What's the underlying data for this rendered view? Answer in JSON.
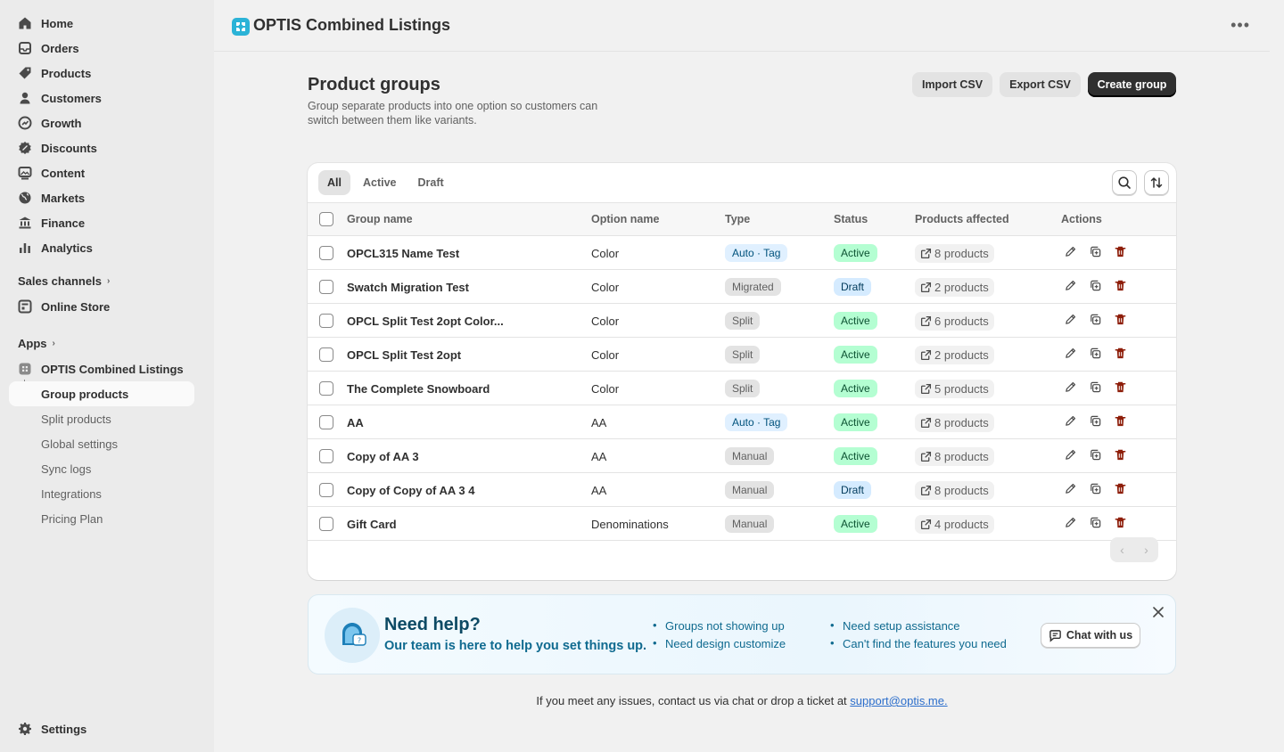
{
  "sidebar": {
    "nav": [
      {
        "label": "Home",
        "icon": "home-icon"
      },
      {
        "label": "Orders",
        "icon": "inbox-icon"
      },
      {
        "label": "Products",
        "icon": "tag-icon"
      },
      {
        "label": "Customers",
        "icon": "person-icon"
      },
      {
        "label": "Growth",
        "icon": "growth-icon"
      },
      {
        "label": "Discounts",
        "icon": "discount-icon"
      },
      {
        "label": "Content",
        "icon": "image-icon"
      },
      {
        "label": "Markets",
        "icon": "globe-icon"
      },
      {
        "label": "Finance",
        "icon": "bank-icon"
      },
      {
        "label": "Analytics",
        "icon": "chart-icon"
      }
    ],
    "sales_channels_label": "Sales channels",
    "online_store_label": "Online Store",
    "apps_label": "Apps",
    "app_name": "OPTIS Combined Listings",
    "app_items": [
      "Group products",
      "Split products",
      "Global settings",
      "Sync logs",
      "Integrations",
      "Pricing Plan"
    ],
    "settings_label": "Settings"
  },
  "header": {
    "app_title": "OPTIS Combined Listings"
  },
  "page": {
    "title": "Product groups",
    "subtitle": "Group separate products into one option so customers can switch between them like variants.",
    "import_label": "Import CSV",
    "export_label": "Export CSV",
    "create_label": "Create group"
  },
  "table": {
    "tabs": [
      "All",
      "Active",
      "Draft"
    ],
    "columns": [
      "Group name",
      "Option name",
      "Type",
      "Status",
      "Products affected",
      "Actions"
    ],
    "rows": [
      {
        "name": "OPCL315 Name Test",
        "option": "Color",
        "type": "Auto · Tag",
        "status": "Active",
        "products": "8 products"
      },
      {
        "name": "Swatch Migration Test",
        "option": "Color",
        "type": "Migrated",
        "status": "Draft",
        "products": "2 products"
      },
      {
        "name": "OPCL Split Test 2opt Color...",
        "option": "Color",
        "type": "Split",
        "status": "Active",
        "products": "6 products"
      },
      {
        "name": "OPCL Split Test 2opt",
        "option": "Color",
        "type": "Split",
        "status": "Active",
        "products": "2 products"
      },
      {
        "name": "The Complete Snowboard",
        "option": "Color",
        "type": "Split",
        "status": "Active",
        "products": "5 products"
      },
      {
        "name": "AA",
        "option": "AA",
        "type": "Auto · Tag",
        "status": "Active",
        "products": "8 products"
      },
      {
        "name": "Copy of AA 3",
        "option": "AA",
        "type": "Manual",
        "status": "Active",
        "products": "8 products"
      },
      {
        "name": "Copy of Copy of AA 3 4",
        "option": "AA",
        "type": "Manual",
        "status": "Draft",
        "products": "8 products"
      },
      {
        "name": "Gift Card",
        "option": "Denominations",
        "type": "Manual",
        "status": "Active",
        "products": "4 products"
      }
    ]
  },
  "help": {
    "title": "Need help?",
    "subtitle": "Our team is here to help you set things up.",
    "list_a": [
      "Groups not showing up",
      "Need design customize"
    ],
    "list_b": [
      "Need setup assistance",
      "Can't find the features you need"
    ],
    "chat_label": "Chat with us"
  },
  "footer": {
    "text": "If you meet any issues, contact us via chat or drop a ticket at ",
    "link": "support@optis.me."
  },
  "colors": {
    "accent": "#303030",
    "active_badge": "#b4fed2",
    "draft_badge": "#d5ebff",
    "delete_icon": "#8e1f0b"
  }
}
